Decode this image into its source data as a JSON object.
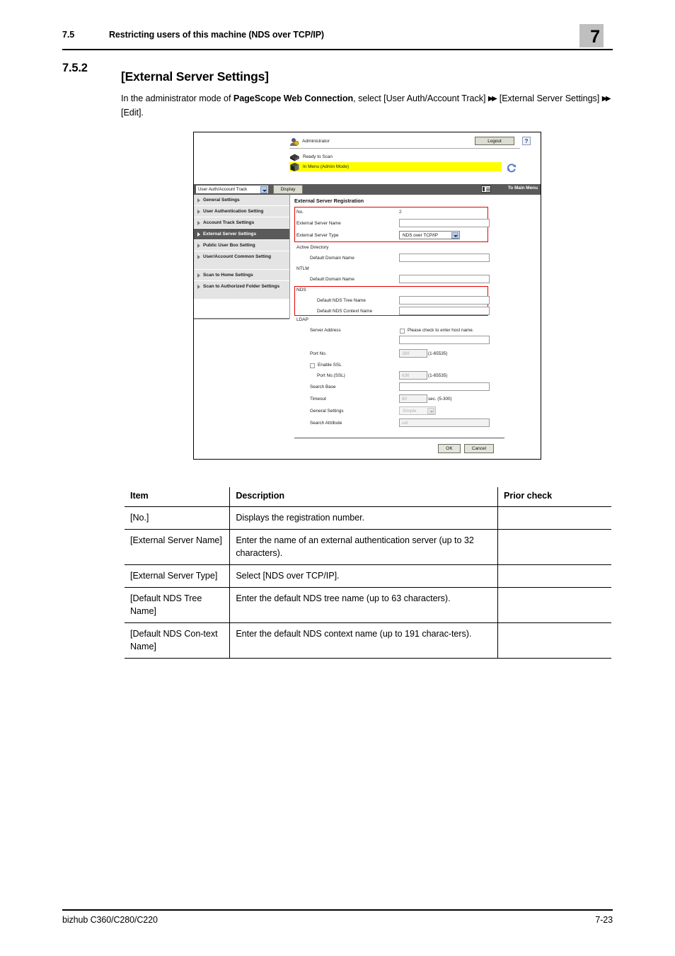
{
  "header": {
    "section_number": "7.5",
    "section_title": "Restricting users of this machine (NDS over TCP/IP)",
    "chapter_tab": "7"
  },
  "section": {
    "number": "7.5.2",
    "title": "[External Server Settings]",
    "intro_part1": "In the administrator mode of ",
    "intro_bold": "PageScope Web Connection",
    "intro_part2": ", select [User Auth/Account Track] ",
    "intro_part3": " [External Server Settings] ",
    "intro_part4": " [Edit]."
  },
  "screenshot": {
    "top": {
      "user_label": "Administrator",
      "logout_label": "Logout",
      "help_label": "?",
      "status_ready": "Ready to Scan",
      "status_menu": "In Menu (Admin Mode)"
    },
    "menubar": {
      "select_value": "User Auth/Account Track",
      "display_button": "Display",
      "to_main_menu": "To Main Menu"
    },
    "sidebar": [
      {
        "label": "General Settings",
        "active": false
      },
      {
        "label": "User Authentication Setting",
        "active": false
      },
      {
        "label": "Account Track Settings",
        "active": false
      },
      {
        "label": "External Server Settings",
        "active": true
      },
      {
        "label": "Public User Box Setting",
        "active": false
      },
      {
        "label": "User/Account Common Setting",
        "active": false
      },
      {
        "label": "Scan to Home Settings",
        "active": false
      },
      {
        "label": "Scan to Authorized Folder Settings",
        "active": false
      }
    ],
    "form": {
      "title": "External Server Registration",
      "no_label": "No.",
      "no_value": "2",
      "server_name_label": "External Server Name",
      "server_name_value": "",
      "server_type_label": "External Server Type",
      "server_type_value": "NDS over TCP/IP",
      "active_directory_group": "Active Directory",
      "ad_domain_label": "Default Domain Name",
      "ad_domain_value": "",
      "ntlm_group": "NTLM",
      "ntlm_domain_label": "Default Domain Name",
      "ntlm_domain_value": "",
      "nds_group": "NDS",
      "nds_tree_label": "Default NDS Tree Name",
      "nds_tree_value": "",
      "nds_context_label": "Default NDS Context Name",
      "nds_context_value": "",
      "ldap_group": "LDAP",
      "server_address_label": "Server Address",
      "host_name_check_label": "Please check to enter host name.",
      "server_address_value": "",
      "port_label": "Port No.",
      "port_value": "389",
      "port_range": "(1-65535)",
      "enable_ssl_label": "Enable SSL",
      "port_ssl_label": "Port No.(SSL)",
      "port_ssl_value": "636",
      "port_ssl_range": "(1-65535)",
      "search_base_label": "Search Base",
      "search_base_value": "",
      "timeout_label": "Timeout",
      "timeout_value": "60",
      "timeout_range": "sec. (5-300)",
      "general_settings_label": "General Settings",
      "general_settings_value": "Simple",
      "search_attribute_label": "Search Attribute",
      "search_attribute_value": "uid",
      "ok_button": "OK",
      "cancel_button": "Cancel"
    }
  },
  "table": {
    "columns": [
      "Item",
      "Description",
      "Prior check"
    ],
    "rows": [
      {
        "item": "[No.]",
        "description": "Displays the registration number.",
        "prior_check": ""
      },
      {
        "item": "[External Server Name]",
        "description": "Enter the name of an external authentication server (up to 32 characters).",
        "prior_check": ""
      },
      {
        "item": "[External Server Type]",
        "description": "Select [NDS over TCP/IP].",
        "prior_check": ""
      },
      {
        "item": "[Default NDS Tree Name]",
        "description": "Enter the default NDS tree name (up to 63 characters).",
        "prior_check": ""
      },
      {
        "item": "[Default NDS Con-text Name]",
        "description": "Enter the default NDS context name (up to 191 charac-ters).",
        "prior_check": ""
      }
    ]
  },
  "footer": {
    "product": "bizhub C360/C280/C220",
    "page": "7-23"
  },
  "colors": {
    "chapter_tab": "#bfbfbf",
    "highlight": "#ffff00",
    "redbox": "#e60000",
    "menubar": "#5a5a5a",
    "sidebar_item": "#e4e4e4",
    "sidebar_active": "#5a5a5a"
  }
}
